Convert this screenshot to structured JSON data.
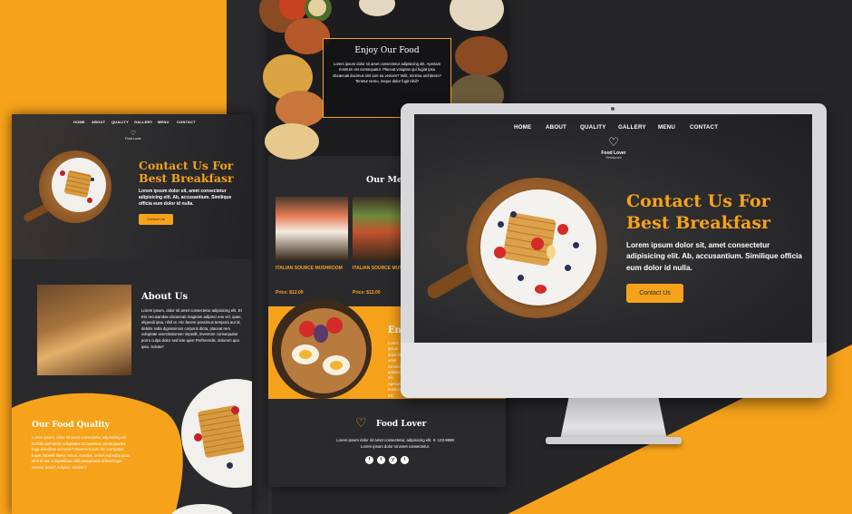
{
  "colors": {
    "accent": "#f7a21b",
    "dark": "#2a2a2d",
    "background": "#262629"
  },
  "left_page": {
    "nav": [
      "HOME",
      "ABOUT",
      "QUALITY",
      "GALLERY",
      "MENU",
      "CONTACT"
    ],
    "hero_title": "Contact Us For Best Breakfasr",
    "hero_text": "Lorem ipsum dolor sit, amet consectetur adipisicing elit. Ab, accusantium. Similique officia eum dolor id nulla.",
    "hero_button": "Contact Us",
    "about_title": "About Us",
    "about_text": "Lorem ipsum, dolor sit amet consectetur adipisicing elit. Et Ein recusandae obcaecati magnam adipisci eos vel, quae, eligendi ipsa, nihil ut. Hic facere possimus tempora aut id, debitis nulla dignissimos corporis dicta, placeat rem voluptate exercitationem impedit, inventore consequatur porro culpa dolor sed iste quis! Perferendis, dolorem quo ipsa. Soluta?",
    "quality_title": "Our Food Quality",
    "quality_text": "Lorem ipsum, dolor sit amet consectetur adipisicing elit. Debitis architecto voluptates accusamus consequuntur fuga doloribus vel esse? Deserunt eum hic corruptam fugiat impedit libero minus, suscipit, omnis expedita quos nihil id iste voluptatibus nihil perspiciatis doloremque tenetur amet? Adipisci, veniam?"
  },
  "mid_page": {
    "enjoy_title": "Enjoy Our Food",
    "enjoy_text": "Lorem ipsum dolor sit amet consectetur adipisicing elit. Aperiam nostrum est consequatur. Placeat voluptas qui fugiat ipsa obcaecati ducimus sint iure ea veniam? Velit, minima architecto? Tenetur nemo, neque dolor fugit nihil?",
    "menu_title": "Our Menu",
    "items": [
      {
        "name": "ITALIAN SOURCE MUSHROOM",
        "price": "Price: $12.00"
      },
      {
        "name": "ITALIAN SOURCE MUSHROOM",
        "price": "Price: $12.00"
      }
    ],
    "enjoy2_title": "Enjoy",
    "enjoy2_text": "Lorem ipsum dolor sit amet consectetur adipisicing elit. Aperiam nostrum est consequatur quae ducimus sint iure.",
    "footer_name": "Food Lover",
    "footer_text_1": "Lorem ipsum dolor sit amet consectetur, adipisicing elit. II- 123-9888",
    "footer_text_2": "Lorem ipsum dolor sit amet consectetur.",
    "social": [
      "f",
      "t",
      "y",
      "i"
    ]
  },
  "monitor": {
    "nav": [
      "HOME",
      "ABOUT",
      "QUALITY",
      "GALLERY",
      "MENU",
      "CONTACT"
    ],
    "logo_name": "Food Lover",
    "logo_sub": "Restaurant",
    "hero_title_line1": "Contact Us For",
    "hero_title_line2": "Best Breakfasr",
    "hero_text": "Lorem ipsum dolor sit, amet consectetur adipisicing elit. Ab, accusantium. Similique officia eum dolor id nulla.",
    "hero_button": "Contact Us"
  }
}
